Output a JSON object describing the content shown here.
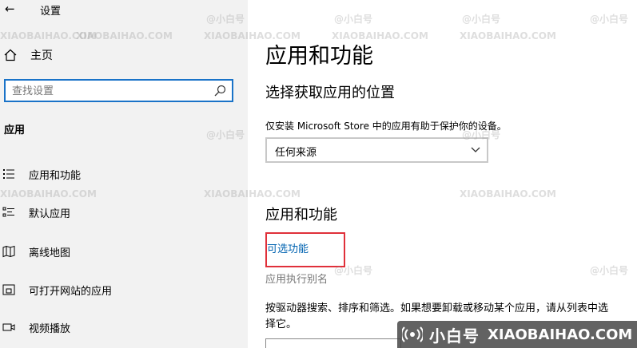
{
  "window": {
    "title": "设置"
  },
  "nav": {
    "home_label": "主页",
    "search_placeholder": "查找设置",
    "section_header": "应用",
    "items": [
      {
        "label": "应用和功能",
        "icon": "apps-list-icon"
      },
      {
        "label": "默认应用",
        "icon": "default-apps-icon"
      },
      {
        "label": "离线地图",
        "icon": "offline-map-icon"
      },
      {
        "label": "可打开网站的应用",
        "icon": "open-websites-icon"
      },
      {
        "label": "视频播放",
        "icon": "video-playback-icon"
      }
    ]
  },
  "content": {
    "page_title": "应用和功能",
    "choose_heading": "选择获取应用的位置",
    "choose_desc": "仅安装 Microsoft Store 中的应用有助于保护你的设备。",
    "source_dropdown": {
      "selected": "任何来源"
    },
    "apps_heading": "应用和功能",
    "optional_features_link": "可选功能",
    "alias_link": "应用执行别名",
    "body_text": "按驱动器搜索、排序和筛选。如果想要卸载或移动某个应用，请从列表中选择它。"
  },
  "watermark": {
    "cn": "@小白号",
    "en": "XIAOBAIHAO.COM",
    "badge_cn": "小白号",
    "badge_en": "XIAOBAIHAO.COM"
  },
  "colors": {
    "accent": "#1a73c8",
    "link": "#0063b1",
    "highlight": "#e0303a",
    "nav_bg": "#f2f2f2"
  }
}
